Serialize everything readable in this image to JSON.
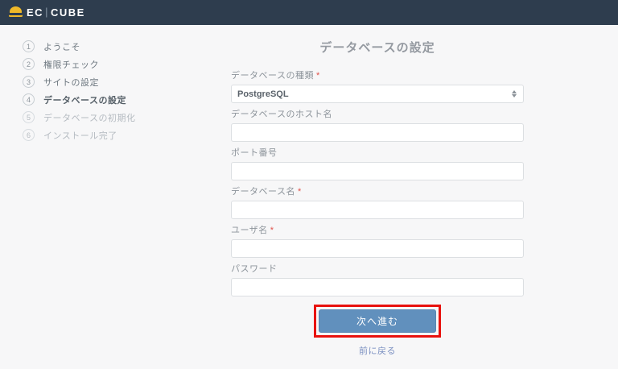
{
  "header": {
    "logo_ec": "EC",
    "logo_sep": "|",
    "logo_cube": "CUBE"
  },
  "steps": [
    {
      "num": "1",
      "label": "ようこそ",
      "state": "done"
    },
    {
      "num": "2",
      "label": "権限チェック",
      "state": "done"
    },
    {
      "num": "3",
      "label": "サイトの設定",
      "state": "done"
    },
    {
      "num": "4",
      "label": "データベースの設定",
      "state": "current"
    },
    {
      "num": "5",
      "label": "データベースの初期化",
      "state": "pending"
    },
    {
      "num": "6",
      "label": "インストール完了",
      "state": "pending"
    }
  ],
  "form": {
    "title": "データベースの設定",
    "required_marker": "*",
    "fields": [
      {
        "label": "データベースの種類",
        "required": true,
        "type": "select",
        "value": "PostgreSQL"
      },
      {
        "label": "データベースのホスト名",
        "required": false,
        "type": "text",
        "value": ""
      },
      {
        "label": "ポート番号",
        "required": false,
        "type": "text",
        "value": ""
      },
      {
        "label": "データベース名",
        "required": true,
        "type": "text",
        "value": ""
      },
      {
        "label": "ユーザ名",
        "required": true,
        "type": "text",
        "value": ""
      },
      {
        "label": "パスワード",
        "required": false,
        "type": "text",
        "value": ""
      }
    ],
    "next_button": "次へ進む",
    "back_link": "前に戻る"
  },
  "colors": {
    "header_bg": "#2e3d4e",
    "logo_yellow": "#f0b929",
    "button_blue": "#6190bd",
    "annotation_red": "#e8120e",
    "link_blue": "#7b90c1",
    "required_red": "#e0524a"
  }
}
